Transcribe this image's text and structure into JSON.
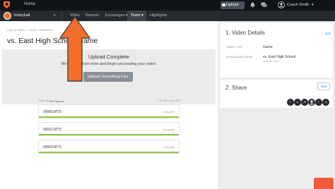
{
  "topbar": {
    "home_label": "Home",
    "upload_label": "Upload",
    "user_name": "Coach Smith",
    "caret": "▾"
  },
  "navbar": {
    "team_name": "Volleyball",
    "team_caret": "▾",
    "items": [
      "Video",
      "Reports",
      "Exchanges ▾",
      "Team ▾",
      "Highlights"
    ],
    "active_item": "Team ▾"
  },
  "main": {
    "breadcrumb": "VOLLEYBALL · HUDL TRAINING",
    "title": "vs. East High School Game",
    "upload": {
      "title": "Upload Complete",
      "subtitle": "We'll take it from here and begin processing your video.",
      "button_label": "Upload Something Else"
    },
    "list": {
      "order_by_label": "Order By",
      "order_by_value": "File Name ▾",
      "size_summary": "2.54 GB / 2.54 GB"
    },
    "files": [
      {
        "name": "00000.MTS",
        "status": "Complete",
        "progress": 1.0
      },
      {
        "name": "00001.MTS",
        "status": "Complete",
        "progress": 1.0
      },
      {
        "name": "00003.MTS",
        "status": "Complete",
        "progress": 1.0
      }
    ]
  },
  "sidebar": {
    "video_details_title": "1. Video Details",
    "edit_label": "Edit",
    "video_type_label": "VIDEO TYPE",
    "video_type_value": "Game",
    "scheduled_event_label": "SCHEDULED EVENT",
    "scheduled_event_value": "vs. East High School",
    "scheduled_event_date": "June 30, 2017",
    "share_title": "2. Share",
    "share_edit_label": "Edit",
    "avatars": [
      "T",
      "A",
      "JS",
      "",
      "T",
      "JJ"
    ]
  },
  "colors": {
    "topbar": "#0f1216",
    "navbar": "#26292e",
    "accent_orange": "#f36d2b",
    "progress_green": "#8cc63f",
    "link_blue": "#3a8fd6"
  }
}
